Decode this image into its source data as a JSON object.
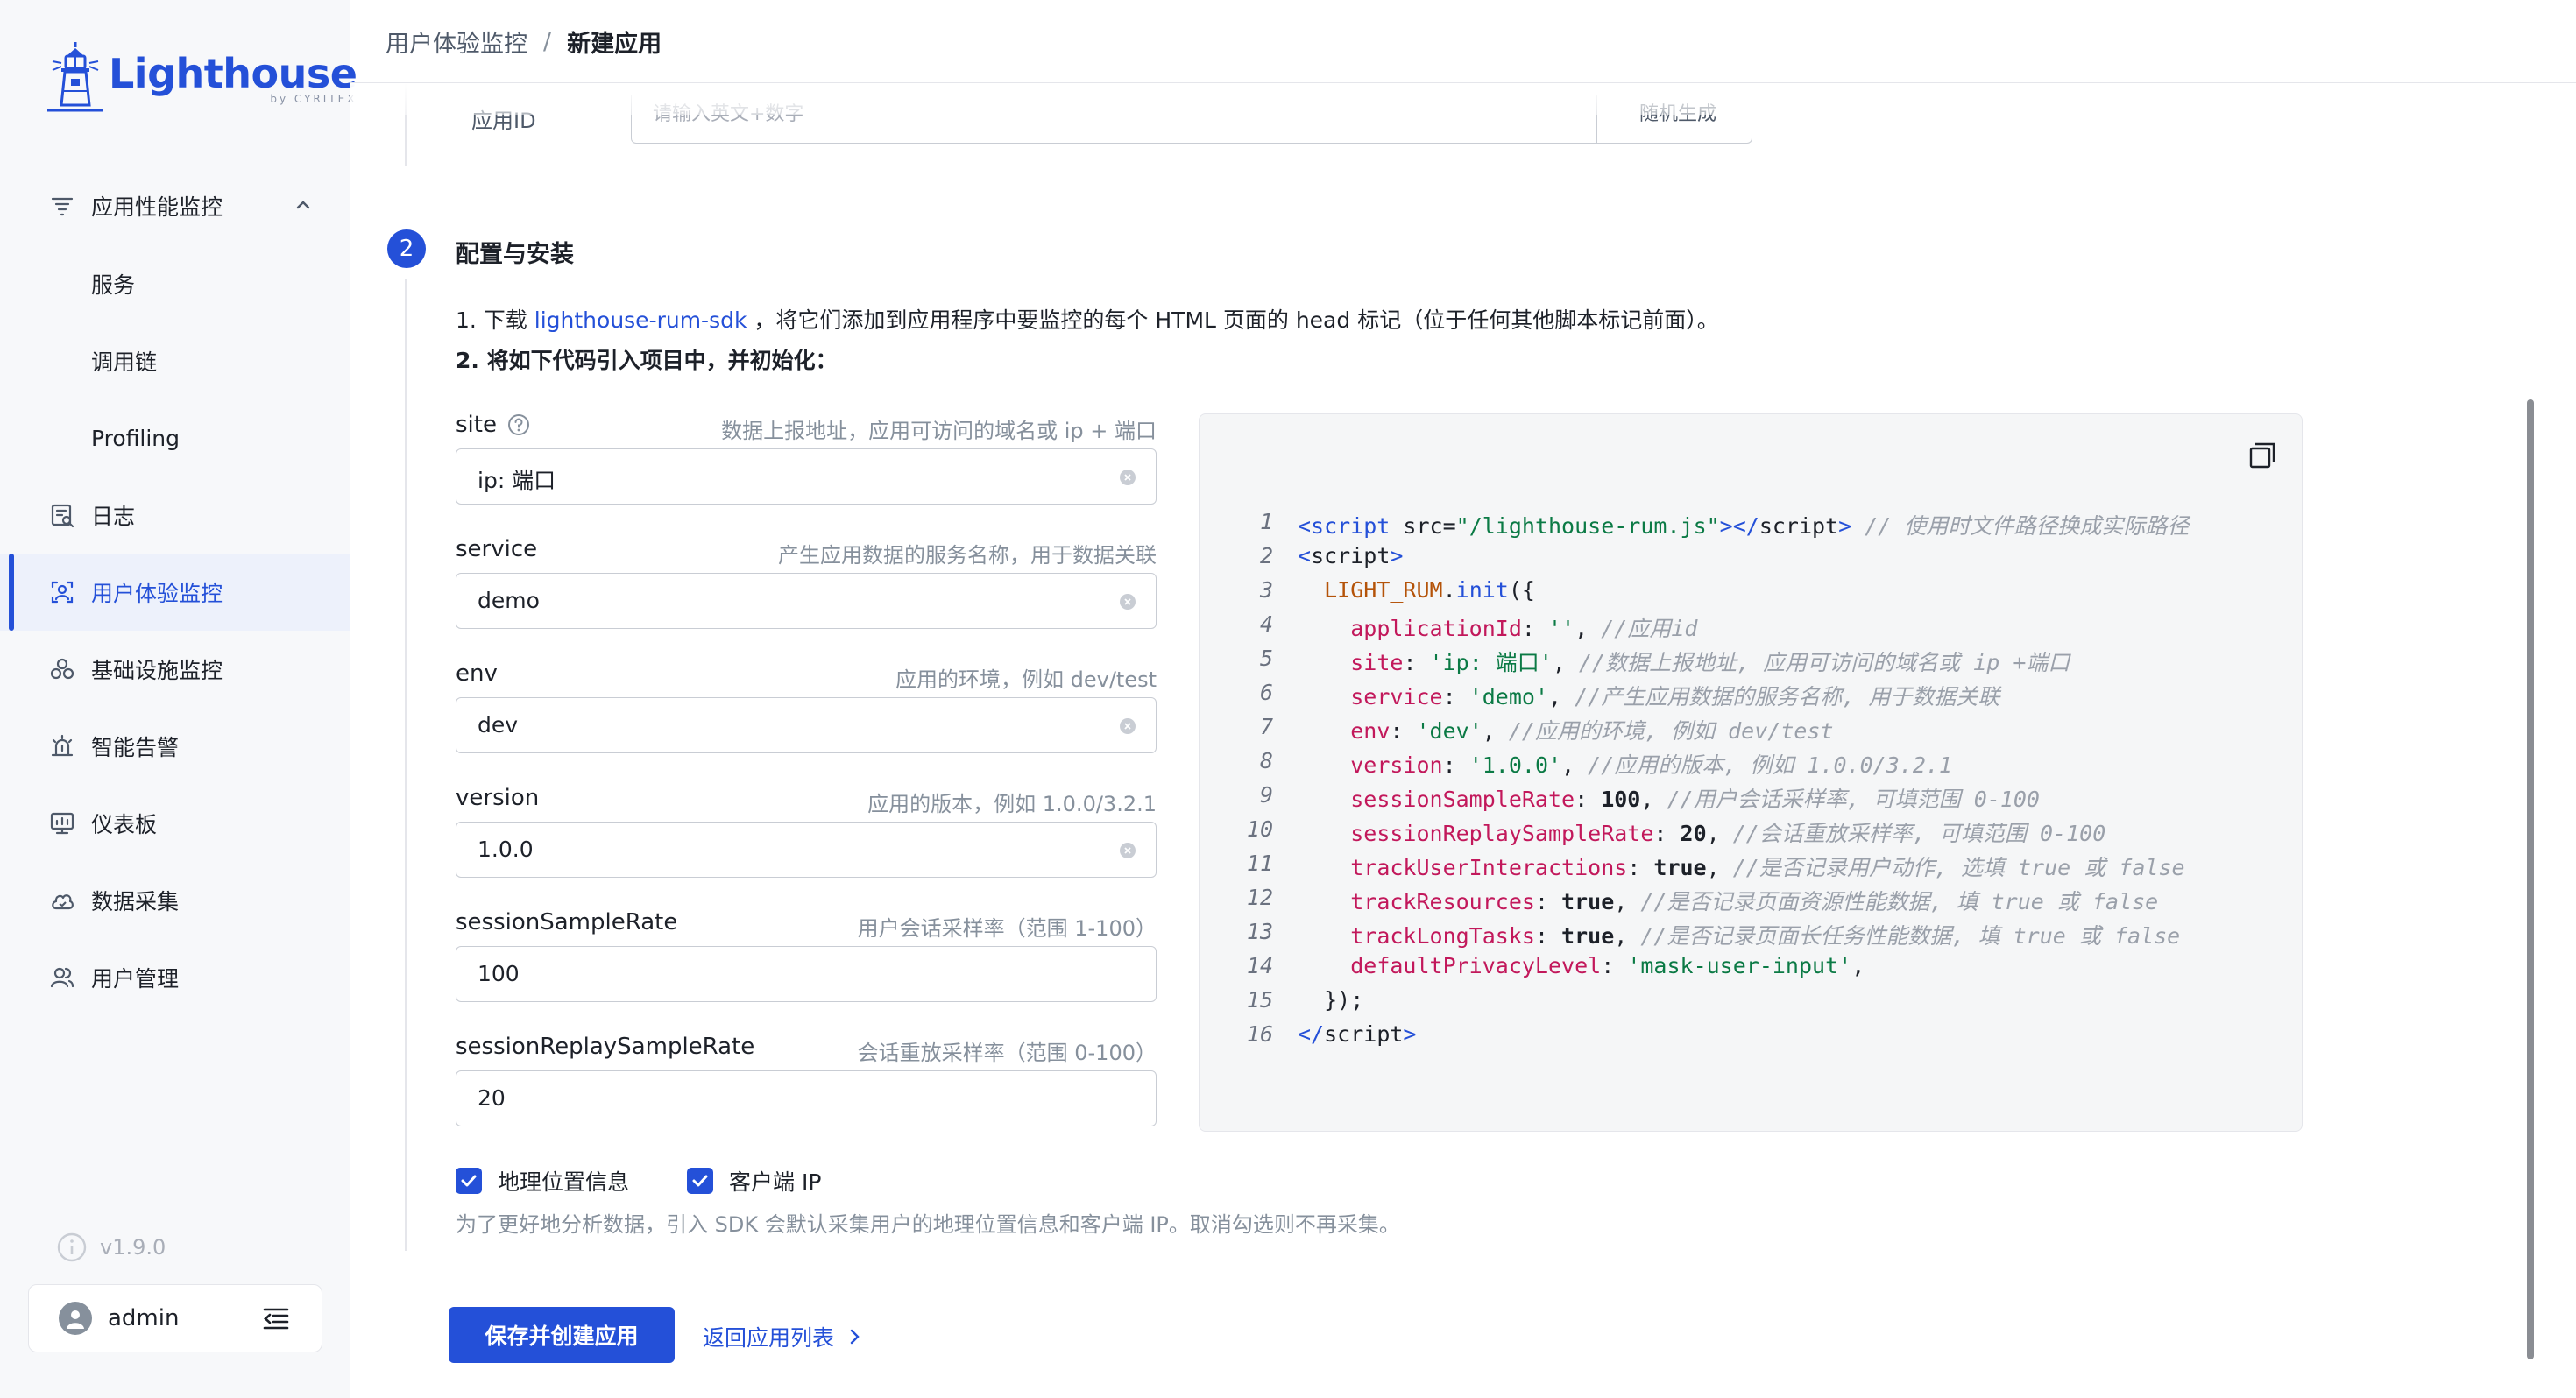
{
  "brand": {
    "name": "Lighthouse",
    "sub": "by CYRITEX",
    "accent": "#2450d8"
  },
  "sidebar": {
    "items": [
      {
        "label": "应用性能监控",
        "icon": "apm-icon"
      },
      {
        "label": "服务"
      },
      {
        "label": "调用链"
      },
      {
        "label": "Profiling"
      },
      {
        "label": "日志",
        "icon": "log-icon"
      },
      {
        "label": "用户体验监控",
        "icon": "rum-icon",
        "active": true
      },
      {
        "label": "基础设施监控",
        "icon": "infra-icon"
      },
      {
        "label": "智能告警",
        "icon": "alarm-icon"
      },
      {
        "label": "仪表板",
        "icon": "dashboard-icon"
      },
      {
        "label": "数据采集",
        "icon": "collect-icon"
      },
      {
        "label": "用户管理",
        "icon": "users-icon"
      }
    ],
    "version": "v1.9.0",
    "user": "admin"
  },
  "breadcrumb": {
    "parent": "用户体验监控",
    "separator": "/",
    "current": "新建应用"
  },
  "step1": {
    "appid_label": "应用ID",
    "appid_placeholder": "请输入英文+数字",
    "generate_label": "随机生成"
  },
  "step2": {
    "number": "2",
    "title": "配置与安装",
    "instr1_prefix": "1. 下载",
    "instr1_link": "lighthouse-rum-sdk",
    "instr1_suffix": "，将它们添加到应用程序中要监控的每个 HTML 页面的 head 标记（位于任何其他脚本标记前面）。",
    "instr2": "2. 将如下代码引入项目中，并初始化："
  },
  "fields": [
    {
      "label": "site",
      "desc": "数据上报地址，应用可访问的域名或 ip + 端口",
      "value": "ip: 端口"
    },
    {
      "label": "service",
      "desc": "产生应用数据的服务名称，用于数据关联",
      "value": "demo"
    },
    {
      "label": "env",
      "desc": "应用的环境，例如 dev/test",
      "value": "dev"
    },
    {
      "label": "version",
      "desc": "应用的版本，例如 1.0.0/3.2.1",
      "value": "1.0.0"
    },
    {
      "label": "sessionSampleRate",
      "desc": "用户会话采样率（范围 1-100）",
      "value": "100"
    },
    {
      "label": "sessionReplaySampleRate",
      "desc": "会话重放采样率（范围 0-100）",
      "value": "20"
    }
  ],
  "code": {
    "line_numbers": [
      "1",
      "2",
      "3",
      "4",
      "5",
      "6",
      "7",
      "8",
      "9",
      "10",
      "11",
      "12",
      "13",
      "14",
      "15",
      "16"
    ],
    "lines": [
      [
        [
          "tag",
          "<script "
        ],
        [
          "plain",
          "src="
        ],
        [
          "str",
          "\"/lighthouse-rum.js\""
        ],
        [
          "tag",
          "></"
        ],
        [
          "plain",
          "script"
        ],
        [
          "tag",
          ">"
        ],
        [
          "cmt",
          " // 使用时文件路径换成实际路径"
        ]
      ],
      [
        [
          "tag",
          "<"
        ],
        [
          "plain",
          "script"
        ],
        [
          "tag",
          ">"
        ]
      ],
      [
        [
          "plain",
          "  "
        ],
        [
          "obj",
          "LIGHT_RUM"
        ],
        [
          "plain",
          "."
        ],
        [
          "fn",
          "init"
        ],
        [
          "plain",
          "({"
        ]
      ],
      [
        [
          "plain",
          "    "
        ],
        [
          "prop",
          "applicationId"
        ],
        [
          "plain",
          ": "
        ],
        [
          "str",
          "''"
        ],
        [
          "plain",
          ", "
        ],
        [
          "cmt",
          "//应用id"
        ]
      ],
      [
        [
          "plain",
          "    "
        ],
        [
          "prop",
          "site"
        ],
        [
          "plain",
          ": "
        ],
        [
          "str",
          "'ip: 端口'"
        ],
        [
          "plain",
          ", "
        ],
        [
          "cmt",
          "//数据上报地址, 应用可访问的域名或 ip +端口"
        ]
      ],
      [
        [
          "plain",
          "    "
        ],
        [
          "prop",
          "service"
        ],
        [
          "plain",
          ": "
        ],
        [
          "str",
          "'demo'"
        ],
        [
          "plain",
          ", "
        ],
        [
          "cmt",
          "//产生应用数据的服务名称, 用于数据关联"
        ]
      ],
      [
        [
          "plain",
          "    "
        ],
        [
          "prop",
          "env"
        ],
        [
          "plain",
          ": "
        ],
        [
          "str",
          "'dev'"
        ],
        [
          "plain",
          ", "
        ],
        [
          "cmt",
          "//应用的环境, 例如 dev/test"
        ]
      ],
      [
        [
          "plain",
          "    "
        ],
        [
          "prop",
          "version"
        ],
        [
          "plain",
          ": "
        ],
        [
          "str",
          "'1.0.0'"
        ],
        [
          "plain",
          ", "
        ],
        [
          "cmt",
          "//应用的版本, 例如 1.0.0/3.2.1"
        ]
      ],
      [
        [
          "plain",
          "    "
        ],
        [
          "prop",
          "sessionSampleRate"
        ],
        [
          "plain",
          ": "
        ],
        [
          "num",
          "100"
        ],
        [
          "plain",
          ", "
        ],
        [
          "cmt",
          "//用户会话采样率, 可填范围 0-100"
        ]
      ],
      [
        [
          "plain",
          "    "
        ],
        [
          "prop",
          "sessionReplaySampleRate"
        ],
        [
          "plain",
          ": "
        ],
        [
          "num",
          "20"
        ],
        [
          "plain",
          ", "
        ],
        [
          "cmt",
          "//会话重放采样率, 可填范围 0-100"
        ]
      ],
      [
        [
          "plain",
          "    "
        ],
        [
          "prop",
          "trackUserInteractions"
        ],
        [
          "plain",
          ": "
        ],
        [
          "bool",
          "true"
        ],
        [
          "plain",
          ", "
        ],
        [
          "cmt",
          "//是否记录用户动作, 选填 true 或 false"
        ]
      ],
      [
        [
          "plain",
          "    "
        ],
        [
          "prop",
          "trackResources"
        ],
        [
          "plain",
          ": "
        ],
        [
          "bool",
          "true"
        ],
        [
          "plain",
          ", "
        ],
        [
          "cmt",
          "//是否记录页面资源性能数据, 填 true 或 false"
        ]
      ],
      [
        [
          "plain",
          "    "
        ],
        [
          "prop",
          "trackLongTasks"
        ],
        [
          "plain",
          ": "
        ],
        [
          "bool",
          "true"
        ],
        [
          "plain",
          ", "
        ],
        [
          "cmt",
          "//是否记录页面长任务性能数据, 填 true 或 false"
        ]
      ],
      [
        [
          "plain",
          "    "
        ],
        [
          "prop",
          "defaultPrivacyLevel"
        ],
        [
          "plain",
          ": "
        ],
        [
          "str",
          "'mask-user-input'"
        ],
        [
          "plain",
          ","
        ]
      ],
      [
        [
          "plain",
          "  });"
        ]
      ],
      [
        [
          "tag",
          "</"
        ],
        [
          "plain",
          "script"
        ],
        [
          "tag",
          ">"
        ]
      ]
    ]
  },
  "checkboxes": [
    {
      "label": "地理位置信息",
      "checked": true
    },
    {
      "label": "客户端 IP",
      "checked": true
    }
  ],
  "hint": "为了更好地分析数据，引入 SDK 会默认采集用户的地理位置信息和客户端 IP。取消勾选则不再采集。",
  "actions": {
    "save": "保存并创建应用",
    "back": "返回应用列表"
  }
}
